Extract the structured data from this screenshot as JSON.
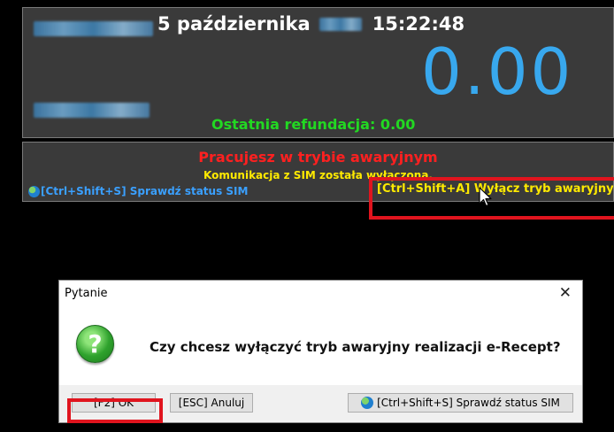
{
  "display": {
    "date": "5 października",
    "time": "15:22:48",
    "amount": "0.00",
    "refund": "Ostatnia refundacja: 0.00"
  },
  "status": {
    "mode": "Pracujesz w trybie awaryjnym",
    "sim_comm": "Komunikacja z SIM została wyłączona.",
    "check_sim": "[Ctrl+Shift+S] Sprawdź status SIM",
    "disable_emergency": "[Ctrl+Shift+A] Wyłącz tryb awaryjny"
  },
  "dialog": {
    "title": "Pytanie",
    "close": "✕",
    "icon_glyph": "?",
    "message": "Czy chcesz wyłączyć tryb awaryjny realizacji e-Recept?",
    "buttons": {
      "ok": "[F2] OK",
      "cancel": "[ESC] Anuluj",
      "check_sim": "[Ctrl+Shift+S] Sprawdź status SIM"
    }
  },
  "colors": {
    "amount": "#38a8ee",
    "refund": "#22d822",
    "mode": "#ff2020",
    "sim_comm": "#ffea00",
    "highlight": "#e0141e"
  },
  "icons": [
    "globe-icon",
    "question-icon",
    "close-icon",
    "mouse-cursor-icon"
  ]
}
